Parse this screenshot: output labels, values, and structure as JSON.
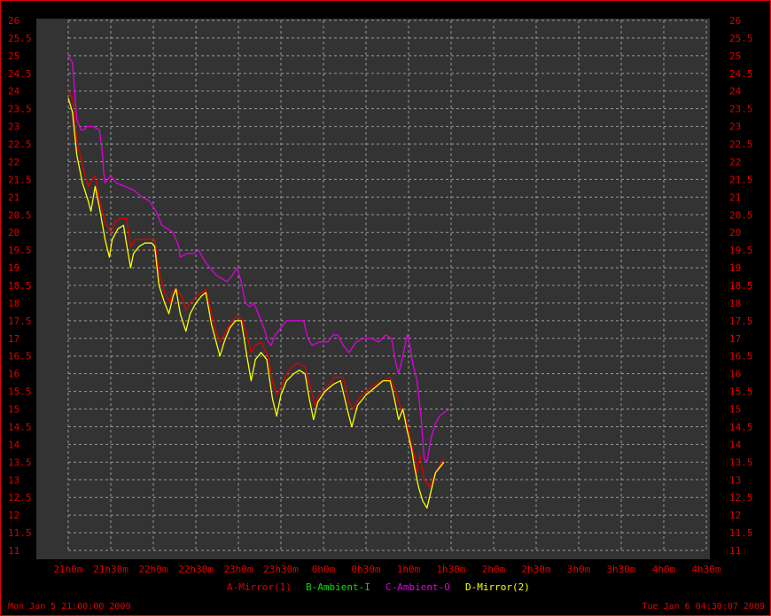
{
  "chart_data": {
    "type": "line",
    "title": "",
    "xlabel": "",
    "ylabel": "",
    "ylim": [
      11,
      26
    ],
    "y_ticks": [
      "11",
      "11.5",
      "12",
      "12.5",
      "13",
      "13.5",
      "14",
      "14.5",
      "15",
      "15.5",
      "16",
      "16.5",
      "17",
      "17.5",
      "18",
      "18.5",
      "19",
      "19.5",
      "20",
      "20.5",
      "21",
      "21.5",
      "22",
      "22.5",
      "23",
      "23.5",
      "24",
      "24.5",
      "25",
      "25.5",
      "26"
    ],
    "x_range_minutes": [
      0,
      450
    ],
    "x_ticks": [
      {
        "label": "21h0m",
        "minute": 0
      },
      {
        "label": "21h30m",
        "minute": 30
      },
      {
        "label": "22h0m",
        "minute": 60
      },
      {
        "label": "22h30m",
        "minute": 90
      },
      {
        "label": "23h0m",
        "minute": 120
      },
      {
        "label": "23h30m",
        "minute": 150
      },
      {
        "label": "0h0m",
        "minute": 180
      },
      {
        "label": "0h30m",
        "minute": 210
      },
      {
        "label": "1h0m",
        "minute": 240
      },
      {
        "label": "1h30m",
        "minute": 270
      },
      {
        "label": "2h0m",
        "minute": 300
      },
      {
        "label": "2h30m",
        "minute": 330
      },
      {
        "label": "3h0m",
        "minute": 360
      },
      {
        "label": "3h30m",
        "minute": 390
      },
      {
        "label": "4h0m",
        "minute": 420
      },
      {
        "label": "4h30m",
        "minute": 450
      }
    ],
    "grid": true,
    "legend_position": "bottom-center",
    "series": [
      {
        "name": "A-Mirror(1)",
        "color": "#e00000",
        "points": [
          [
            0,
            24.0
          ],
          [
            3,
            23.8
          ],
          [
            6,
            22.6
          ],
          [
            10,
            21.9
          ],
          [
            14,
            21.3
          ],
          [
            17,
            21.5
          ],
          [
            19,
            21.6
          ],
          [
            22,
            20.9
          ],
          [
            26,
            20.3
          ],
          [
            30,
            20.0
          ],
          [
            33,
            20.3
          ],
          [
            37,
            20.4
          ],
          [
            41,
            20.4
          ],
          [
            44,
            19.6
          ],
          [
            47,
            19.8
          ],
          [
            51,
            19.8
          ],
          [
            55,
            19.8
          ],
          [
            61,
            19.8
          ],
          [
            64,
            18.9
          ],
          [
            68,
            18.3
          ],
          [
            72,
            18.0
          ],
          [
            73,
            18.3
          ],
          [
            76,
            18.4
          ],
          [
            80,
            18.2
          ],
          [
            83,
            17.8
          ],
          [
            86,
            18.0
          ],
          [
            90,
            18.2
          ],
          [
            94,
            18.3
          ],
          [
            97,
            18.4
          ],
          [
            101,
            17.7
          ],
          [
            104,
            17.2
          ],
          [
            107,
            16.9
          ],
          [
            110,
            17.1
          ],
          [
            114,
            17.4
          ],
          [
            118,
            17.6
          ],
          [
            122,
            17.6
          ],
          [
            126,
            17.1
          ],
          [
            129,
            16.6
          ],
          [
            132,
            16.8
          ],
          [
            136,
            16.9
          ],
          [
            141,
            16.5
          ],
          [
            144,
            15.8
          ],
          [
            147,
            15.4
          ],
          [
            151,
            15.7
          ],
          [
            154,
            16.0
          ],
          [
            158,
            16.2
          ],
          [
            162,
            16.3
          ],
          [
            167,
            16.2
          ],
          [
            171,
            15.6
          ],
          [
            174,
            15.1
          ],
          [
            177,
            15.4
          ],
          [
            182,
            15.6
          ],
          [
            188,
            15.9
          ],
          [
            194,
            15.9
          ],
          [
            198,
            15.2
          ],
          [
            201,
            15.0
          ],
          [
            205,
            15.3
          ],
          [
            210,
            15.5
          ],
          [
            216,
            15.7
          ],
          [
            222,
            15.8
          ],
          [
            227,
            15.9
          ],
          [
            231,
            15.5
          ],
          [
            234,
            15.1
          ],
          [
            239,
            14.6
          ],
          [
            242,
            14.0
          ],
          [
            244,
            13.7
          ],
          [
            246,
            13.2
          ],
          [
            248,
            13.7
          ],
          [
            251,
            13.0
          ],
          [
            255,
            12.8
          ],
          [
            259,
            13.2
          ],
          [
            265,
            13.6
          ]
        ]
      },
      {
        "name": "B-Ambient-I",
        "color": "#00e000",
        "points": []
      },
      {
        "name": "C-Ambient-O",
        "color": "#e000e0",
        "points": [
          [
            0,
            25.0
          ],
          [
            3,
            24.8
          ],
          [
            6,
            23.2
          ],
          [
            9,
            22.9
          ],
          [
            11,
            22.9
          ],
          [
            13,
            23.0
          ],
          [
            17,
            23.0
          ],
          [
            22,
            22.9
          ],
          [
            24,
            22.3
          ],
          [
            25,
            21.7
          ],
          [
            26,
            21.4
          ],
          [
            30,
            21.6
          ],
          [
            34,
            21.4
          ],
          [
            40,
            21.3
          ],
          [
            46,
            21.2
          ],
          [
            52,
            21.0
          ],
          [
            57,
            20.9
          ],
          [
            62,
            20.6
          ],
          [
            66,
            20.2
          ],
          [
            70,
            20.1
          ],
          [
            74,
            20.0
          ],
          [
            78,
            19.6
          ],
          [
            79,
            19.3
          ],
          [
            84,
            19.4
          ],
          [
            88,
            19.4
          ],
          [
            92,
            19.5
          ],
          [
            96,
            19.2
          ],
          [
            100,
            19.0
          ],
          [
            104,
            18.8
          ],
          [
            108,
            18.7
          ],
          [
            112,
            18.6
          ],
          [
            116,
            18.8
          ],
          [
            119,
            19.0
          ],
          [
            122,
            18.6
          ],
          [
            125,
            18.0
          ],
          [
            128,
            17.9
          ],
          [
            131,
            18.0
          ],
          [
            135,
            17.6
          ],
          [
            138,
            17.3
          ],
          [
            141,
            16.9
          ],
          [
            143,
            16.8
          ],
          [
            146,
            17.1
          ],
          [
            150,
            17.3
          ],
          [
            154,
            17.5
          ],
          [
            160,
            17.5
          ],
          [
            166,
            17.5
          ],
          [
            169,
            17.0
          ],
          [
            172,
            16.8
          ],
          [
            177,
            16.9
          ],
          [
            183,
            16.9
          ],
          [
            187,
            17.1
          ],
          [
            190,
            17.1
          ],
          [
            194,
            16.8
          ],
          [
            198,
            16.6
          ],
          [
            203,
            16.9
          ],
          [
            208,
            17.0
          ],
          [
            214,
            17.0
          ],
          [
            219,
            16.9
          ],
          [
            224,
            17.1
          ],
          [
            228,
            17.0
          ],
          [
            231,
            16.3
          ],
          [
            233,
            16.0
          ],
          [
            236,
            16.5
          ],
          [
            239,
            17.1
          ],
          [
            241,
            16.8
          ],
          [
            243,
            16.3
          ],
          [
            246,
            15.8
          ],
          [
            249,
            14.7
          ],
          [
            251,
            13.6
          ],
          [
            253,
            13.5
          ],
          [
            256,
            14.2
          ],
          [
            259,
            14.6
          ],
          [
            262,
            14.8
          ],
          [
            265,
            14.9
          ],
          [
            269,
            15.0
          ]
        ]
      },
      {
        "name": "D-Mirror(2)",
        "color": "#ffff00",
        "points": [
          [
            0,
            23.8
          ],
          [
            3,
            23.4
          ],
          [
            6,
            22.2
          ],
          [
            10,
            21.4
          ],
          [
            14,
            20.9
          ],
          [
            16,
            20.6
          ],
          [
            19,
            21.3
          ],
          [
            22,
            20.7
          ],
          [
            26,
            19.8
          ],
          [
            29,
            19.3
          ],
          [
            31,
            19.8
          ],
          [
            35,
            20.1
          ],
          [
            39,
            20.2
          ],
          [
            41,
            19.7
          ],
          [
            44,
            19.0
          ],
          [
            46,
            19.4
          ],
          [
            50,
            19.6
          ],
          [
            54,
            19.7
          ],
          [
            59,
            19.7
          ],
          [
            61,
            19.6
          ],
          [
            64,
            18.5
          ],
          [
            68,
            18.0
          ],
          [
            71,
            17.7
          ],
          [
            74,
            18.2
          ],
          [
            76,
            18.4
          ],
          [
            79,
            17.7
          ],
          [
            83,
            17.2
          ],
          [
            86,
            17.7
          ],
          [
            90,
            18.0
          ],
          [
            94,
            18.2
          ],
          [
            97,
            18.3
          ],
          [
            101,
            17.4
          ],
          [
            105,
            16.8
          ],
          [
            107,
            16.5
          ],
          [
            110,
            16.9
          ],
          [
            114,
            17.3
          ],
          [
            118,
            17.5
          ],
          [
            122,
            17.5
          ],
          [
            126,
            16.5
          ],
          [
            129,
            15.8
          ],
          [
            132,
            16.4
          ],
          [
            136,
            16.6
          ],
          [
            140,
            16.4
          ],
          [
            144,
            15.3
          ],
          [
            147,
            14.8
          ],
          [
            150,
            15.4
          ],
          [
            154,
            15.8
          ],
          [
            159,
            16.0
          ],
          [
            163,
            16.1
          ],
          [
            167,
            16.0
          ],
          [
            170,
            15.3
          ],
          [
            173,
            14.7
          ],
          [
            176,
            15.2
          ],
          [
            181,
            15.5
          ],
          [
            187,
            15.7
          ],
          [
            192,
            15.8
          ],
          [
            195,
            15.3
          ],
          [
            198,
            14.8
          ],
          [
            200,
            14.5
          ],
          [
            204,
            15.1
          ],
          [
            210,
            15.4
          ],
          [
            216,
            15.6
          ],
          [
            222,
            15.8
          ],
          [
            227,
            15.8
          ],
          [
            230,
            15.3
          ],
          [
            233,
            14.7
          ],
          [
            236,
            15.0
          ],
          [
            239,
            14.4
          ],
          [
            242,
            13.9
          ],
          [
            244,
            13.4
          ],
          [
            247,
            12.8
          ],
          [
            250,
            12.4
          ],
          [
            253,
            12.2
          ],
          [
            256,
            12.7
          ],
          [
            259,
            13.2
          ],
          [
            263,
            13.4
          ],
          [
            265,
            13.5
          ]
        ]
      }
    ]
  },
  "footer": {
    "left": "Mon Jan  5 21:00:00 2009",
    "right": "Tue Jan  6 04:30:07 2009"
  }
}
